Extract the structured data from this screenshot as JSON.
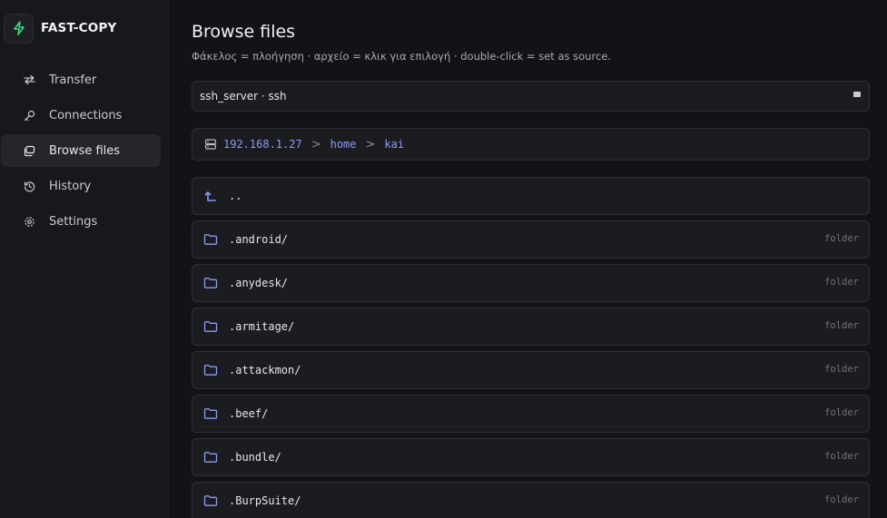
{
  "app": {
    "name": "FAST-COPY"
  },
  "sidebar": {
    "items": [
      {
        "label": "Transfer",
        "icon": "arrows-swap-icon"
      },
      {
        "label": "Connections",
        "icon": "key-icon"
      },
      {
        "label": "Browse files",
        "icon": "browse-icon",
        "active": true
      },
      {
        "label": "History",
        "icon": "history-icon"
      },
      {
        "label": "Settings",
        "icon": "gear-icon"
      }
    ]
  },
  "header": {
    "title": "Browse files",
    "subtitle": "Φάκελος = πλοήγηση · αρχείο = κλικ για επιλογή · double-click = set as source."
  },
  "source": {
    "value": "ssh_server · ssh"
  },
  "breadcrumb": {
    "parts": [
      "192.168.1.27",
      "home",
      "kai"
    ],
    "separator": ">"
  },
  "listing": {
    "parent": "..",
    "entries": [
      {
        "name": ".android/",
        "kind": "folder"
      },
      {
        "name": ".anydesk/",
        "kind": "folder"
      },
      {
        "name": ".armitage/",
        "kind": "folder"
      },
      {
        "name": ".attackmon/",
        "kind": "folder"
      },
      {
        "name": ".beef/",
        "kind": "folder"
      },
      {
        "name": ".bundle/",
        "kind": "folder"
      },
      {
        "name": ".BurpSuite/",
        "kind": "folder"
      }
    ]
  },
  "colors": {
    "accent": "#8c9bf0",
    "brand": "#3ddc84",
    "background": "#121317",
    "sidebar": "#17181c"
  }
}
